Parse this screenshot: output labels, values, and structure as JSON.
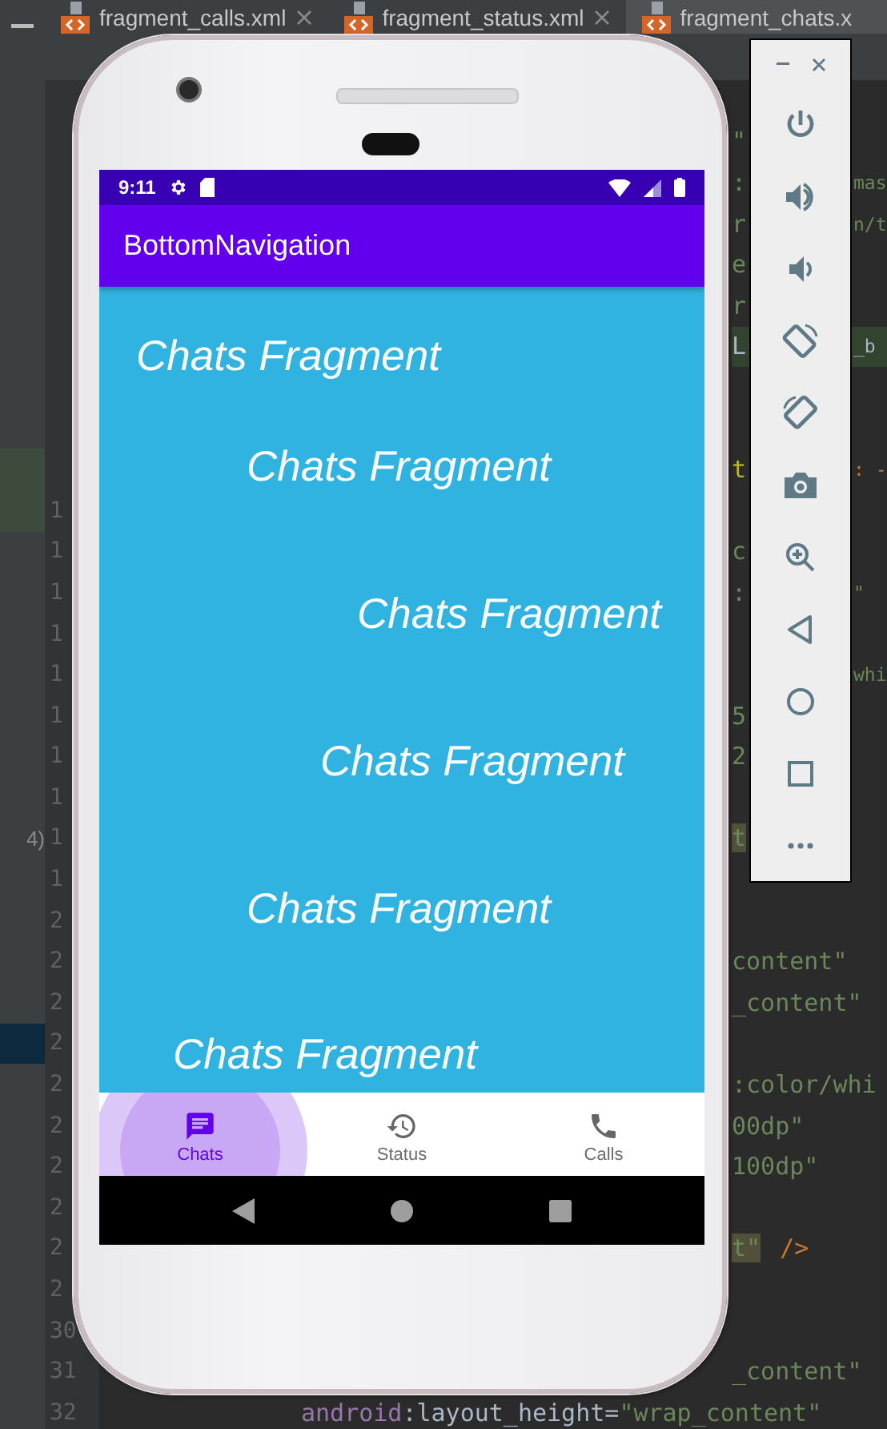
{
  "editor_tabs": [
    {
      "label": "fragment_calls.xml",
      "selected": false,
      "closable": true
    },
    {
      "label": "fragment_status.xml",
      "selected": false,
      "closable": true
    },
    {
      "label": "fragment_chats.x",
      "selected": true,
      "closable": false
    }
  ],
  "editor_rows": [
    {},
    {
      "left": [
        {
          "text": "\"",
          "kind": "string"
        }
      ]
    },
    {
      "left": [
        {
          "text": ":",
          "kind": "string"
        }
      ],
      "right": [
        {
          "text": "mas",
          "kind": "string"
        }
      ]
    },
    {
      "left": [
        {
          "text": "r",
          "kind": "string"
        }
      ],
      "right": [
        {
          "text": "n/t",
          "kind": "string"
        }
      ]
    },
    {
      "left": [
        {
          "text": "e",
          "kind": "string"
        }
      ]
    },
    {
      "left": [
        {
          "text": "r",
          "kind": "string"
        }
      ]
    },
    {
      "line_highlight": true,
      "left": [
        {
          "text": "L",
          "kind": "plain"
        }
      ],
      "right": [
        {
          "text": "_b",
          "kind": "plain"
        }
      ]
    },
    {},
    {},
    {
      "side": {
        "kind": "change"
      },
      "left": [
        {
          "text": "t",
          "kind": "attr"
        }
      ],
      "right": [
        {
          "text": ": -",
          "kind": "punct"
        }
      ]
    },
    {
      "side": {
        "kind": "change"
      },
      "number": "1"
    },
    {
      "number": "1",
      "left": [
        {
          "text": "c",
          "kind": "string"
        }
      ]
    },
    {
      "number": "1",
      "left": [
        {
          "text": ":",
          "kind": "string"
        }
      ],
      "right": [
        {
          "text": "\"",
          "kind": "string"
        }
      ]
    },
    {
      "number": "1"
    },
    {
      "number": "1",
      "right": [
        {
          "text": "whi",
          "kind": "string"
        }
      ]
    },
    {
      "number": "1",
      "left": [
        {
          "text": "5",
          "kind": "string"
        }
      ]
    },
    {
      "number": "1",
      "left": [
        {
          "text": "2",
          "kind": "string"
        }
      ]
    },
    {
      "number": "1"
    },
    {
      "number": "1",
      "side": {
        "kind": "note",
        "text": "4)"
      },
      "left": [
        {
          "text": "t",
          "kind": "string",
          "highlight": true
        }
      ]
    },
    {
      "number": "1"
    },
    {
      "number": "2"
    },
    {
      "number": "2",
      "left": [
        {
          "text": "content\"",
          "kind": "string"
        }
      ]
    },
    {
      "number": "2",
      "left": [
        {
          "text": "_content\"",
          "kind": "string"
        }
      ]
    },
    {
      "number": "2",
      "side": {
        "kind": "selection"
      }
    },
    {
      "number": "2",
      "left": [
        {
          "text": ":color/whi",
          "kind": "string"
        }
      ]
    },
    {
      "number": "2",
      "left": [
        {
          "text": "00dp\"",
          "kind": "string"
        }
      ]
    },
    {
      "number": "2",
      "left": [
        {
          "text": "100dp\"",
          "kind": "string"
        }
      ]
    },
    {
      "number": "2"
    },
    {
      "number": "2",
      "left": [
        {
          "text": "t\"",
          "kind": "string",
          "highlight": true
        },
        {
          "text": "/>",
          "kind": "punct"
        }
      ]
    },
    {
      "number": "2"
    },
    {
      "number": "30"
    },
    {
      "number": "31",
      "left": [
        {
          "text": "_content\"",
          "kind": "string"
        }
      ]
    },
    {
      "number": "32",
      "kind": "wide",
      "left": [
        {
          "text": "android",
          "kind": "ns"
        },
        {
          "text": ":layout_height=",
          "kind": "plain"
        },
        {
          "text": "\"wrap_content\"",
          "kind": "string"
        }
      ]
    }
  ],
  "phone": {
    "status_bar": {
      "time": "9:11"
    },
    "app_bar": {
      "title": "BottomNavigation"
    },
    "fragment_texts": [
      "Chats Fragment",
      "Chats Fragment",
      "Chats Fragment",
      "Chats Fragment",
      "Chats Fragment",
      "Chats Fragment"
    ],
    "bottom_nav": [
      {
        "label": "Chats",
        "selected": true
      },
      {
        "label": "Status",
        "selected": false
      },
      {
        "label": "Calls",
        "selected": false
      }
    ]
  }
}
